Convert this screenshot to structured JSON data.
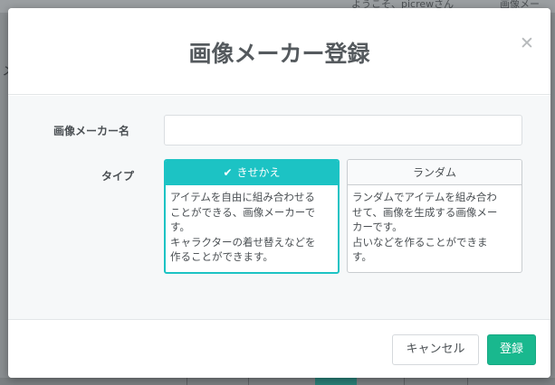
{
  "background": {
    "greeting": "ようこそ、picrewさん",
    "right_text": "画像メー",
    "left_glyph": "メ"
  },
  "modal": {
    "title": "画像メーカー登録",
    "close_icon": "close-icon",
    "name_field": {
      "label": "画像メーカー名",
      "value": "",
      "placeholder": ""
    },
    "type_field": {
      "label": "タイプ",
      "options": [
        {
          "label": "きせかえ",
          "selected": true,
          "icon": "check-icon",
          "description": "アイテムを自由に組み合わせる\nことができる、画像メーカーで\nす。\nキャラクターの着せ替えなどを\n作ることができます。"
        },
        {
          "label": "ランダム",
          "selected": false,
          "description": "ランダムでアイテムを組み合わ\nせて、画像を生成する画像メー\nカーです。\n占いなどを作ることができま\nす。"
        }
      ]
    },
    "buttons": {
      "cancel": "キャンセル",
      "submit": "登録"
    }
  },
  "colors": {
    "accent_teal": "#1cc3c4",
    "submit_green": "#19b88e",
    "overlay": "#6f7376"
  }
}
